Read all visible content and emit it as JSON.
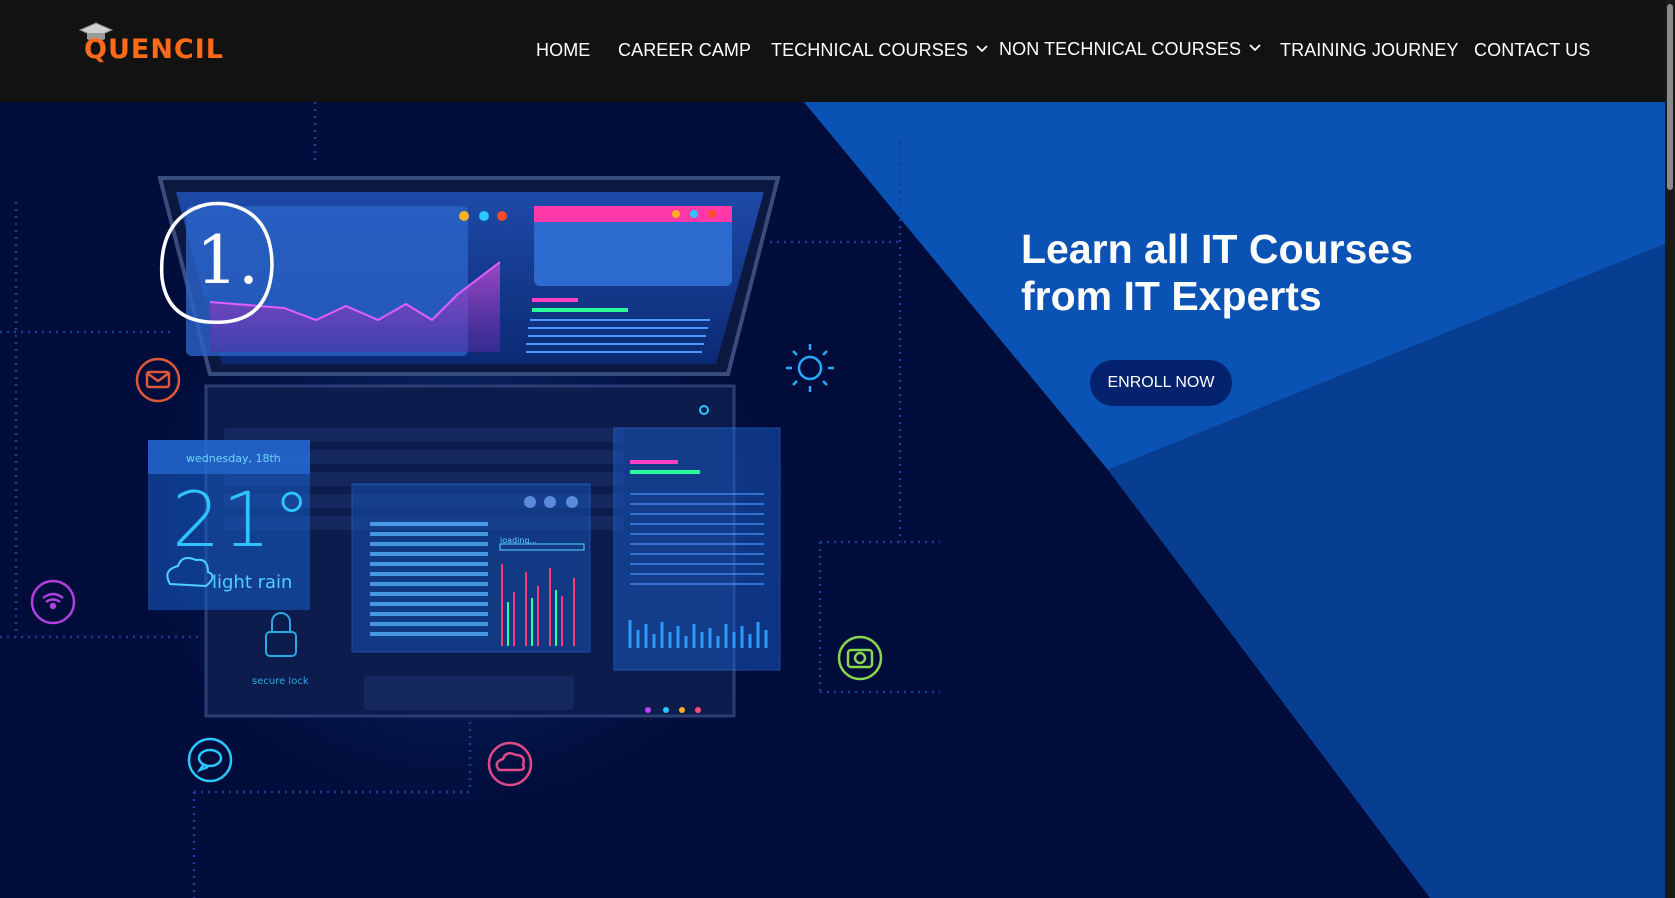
{
  "brand": {
    "name": "Quencil",
    "logo_text": "QUENCIL",
    "accent": "#ff6a1a"
  },
  "nav": {
    "items": [
      {
        "label": "HOME"
      },
      {
        "label": "CAREER CAMP"
      },
      {
        "label": "TECHNICAL COURSES",
        "has_dropdown": true
      },
      {
        "label": "NON TECHNICAL COURSES",
        "has_dropdown": true
      },
      {
        "label": "TRAINING JOURNEY"
      },
      {
        "label": "CONTACT US"
      }
    ]
  },
  "hero": {
    "headline_line1": "Learn all IT Courses",
    "headline_line2": "from IT Experts",
    "cta_label": "ENROLL NOW",
    "annotation": "1."
  },
  "illustration": {
    "weather_date": "wednesday, 18th",
    "temperature": "21°",
    "weather_desc": "light rain",
    "lock_label": "secure lock",
    "loading_label": "loading..."
  },
  "colors": {
    "nav_bg": "#121212",
    "hero_dark": "#000c3a",
    "hero_blue": "#0a52b4",
    "hero_mid": "#083e92",
    "button_bg": "#04226e"
  }
}
